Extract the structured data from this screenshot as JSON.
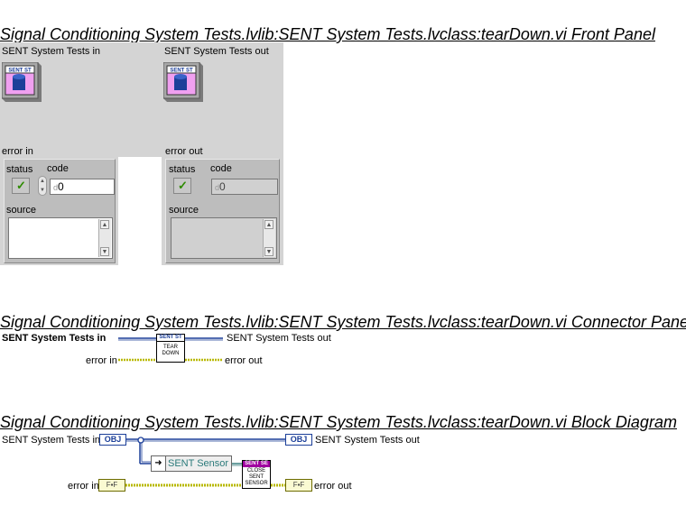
{
  "headings": {
    "front_panel": "Signal Conditioning System Tests.lvlib:SENT System Tests.lvclass:tearDown.vi Front Panel",
    "connector_pane": "Signal Conditioning System Tests.lvlib:SENT System Tests.lvclass:tearDown.vi Connector Pane",
    "block_diagram": "Signal Conditioning System Tests.lvlib:SENT System Tests.lvclass:tearDown.vi Block Diagram"
  },
  "front_panel": {
    "obj_in_label": "SENT System Tests in",
    "obj_out_label": "SENT System Tests out",
    "obj_icon_text": "SENT ST",
    "error_in": {
      "label": "error in",
      "status_label": "status",
      "code_label": "code",
      "code_value": "0",
      "code_radix": "d",
      "source_label": "source",
      "status_glyph": "✓"
    },
    "error_out": {
      "label": "error out",
      "status_label": "status",
      "code_label": "code",
      "code_value": "0",
      "code_radix": "d",
      "source_label": "source",
      "status_glyph": "✓"
    }
  },
  "connector_pane": {
    "left_top": "SENT System Tests in",
    "left_bottom": "error in",
    "right_top": "SENT System Tests out",
    "right_bottom": "error out",
    "icon_header": "SENT ST",
    "icon_line1": "TEAR",
    "icon_line2": "DOWN"
  },
  "block_diagram": {
    "obj_in_label": "SENT System Tests in",
    "obj_out_label": "SENT System Tests out",
    "error_in_label": "error in",
    "error_out_label": "error out",
    "obj_terminal_text": "OBJ",
    "err_terminal_text": "F▪F",
    "unbundle_label": "SENT Sensor",
    "close_header": "SENT SE",
    "close_line1": "CLOSE",
    "close_line2": "SENT",
    "close_line3": "SENSOR"
  },
  "colors": {
    "panel_bg": "#d4d4d4",
    "class_wire": "#1c3f99",
    "error_wire": "#b8b800",
    "led_check": "#2e8b00"
  }
}
